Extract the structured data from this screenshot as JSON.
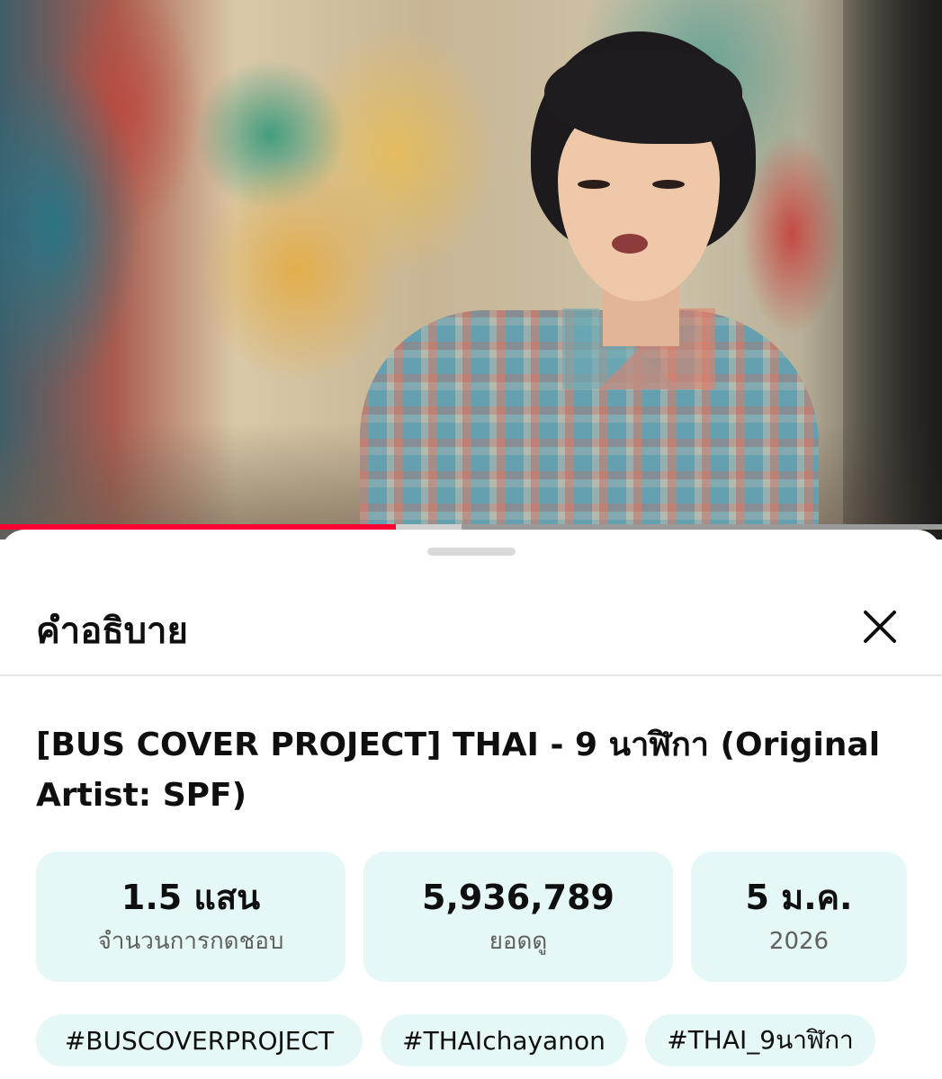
{
  "video": {
    "progress_played_fraction": 0.42,
    "progress_buffered_fraction": 0.49
  },
  "sheet": {
    "title": "คำอธิบาย",
    "close_icon": "close-icon"
  },
  "description": {
    "video_title": "[BUS COVER PROJECT] THAI - 9 นาฬิกา (Original Artist: SPF)",
    "stats": {
      "likes": {
        "value": "1.5 แสน",
        "label": "จำนวนการกดชอบ"
      },
      "views": {
        "value": "5,936,789",
        "label": "ยอดดู"
      },
      "date": {
        "value": "5 ม.ค.",
        "label": "2026"
      }
    },
    "hashtags": [
      "#BUSCOVERPROJECT",
      "#THAIchayanon",
      "#THAI_9นาฬิกา"
    ]
  },
  "colors": {
    "progress_played": "#ff0033",
    "chip_background": "#e6f7f8",
    "text_primary": "#0f0f0f",
    "text_secondary": "#606060"
  }
}
